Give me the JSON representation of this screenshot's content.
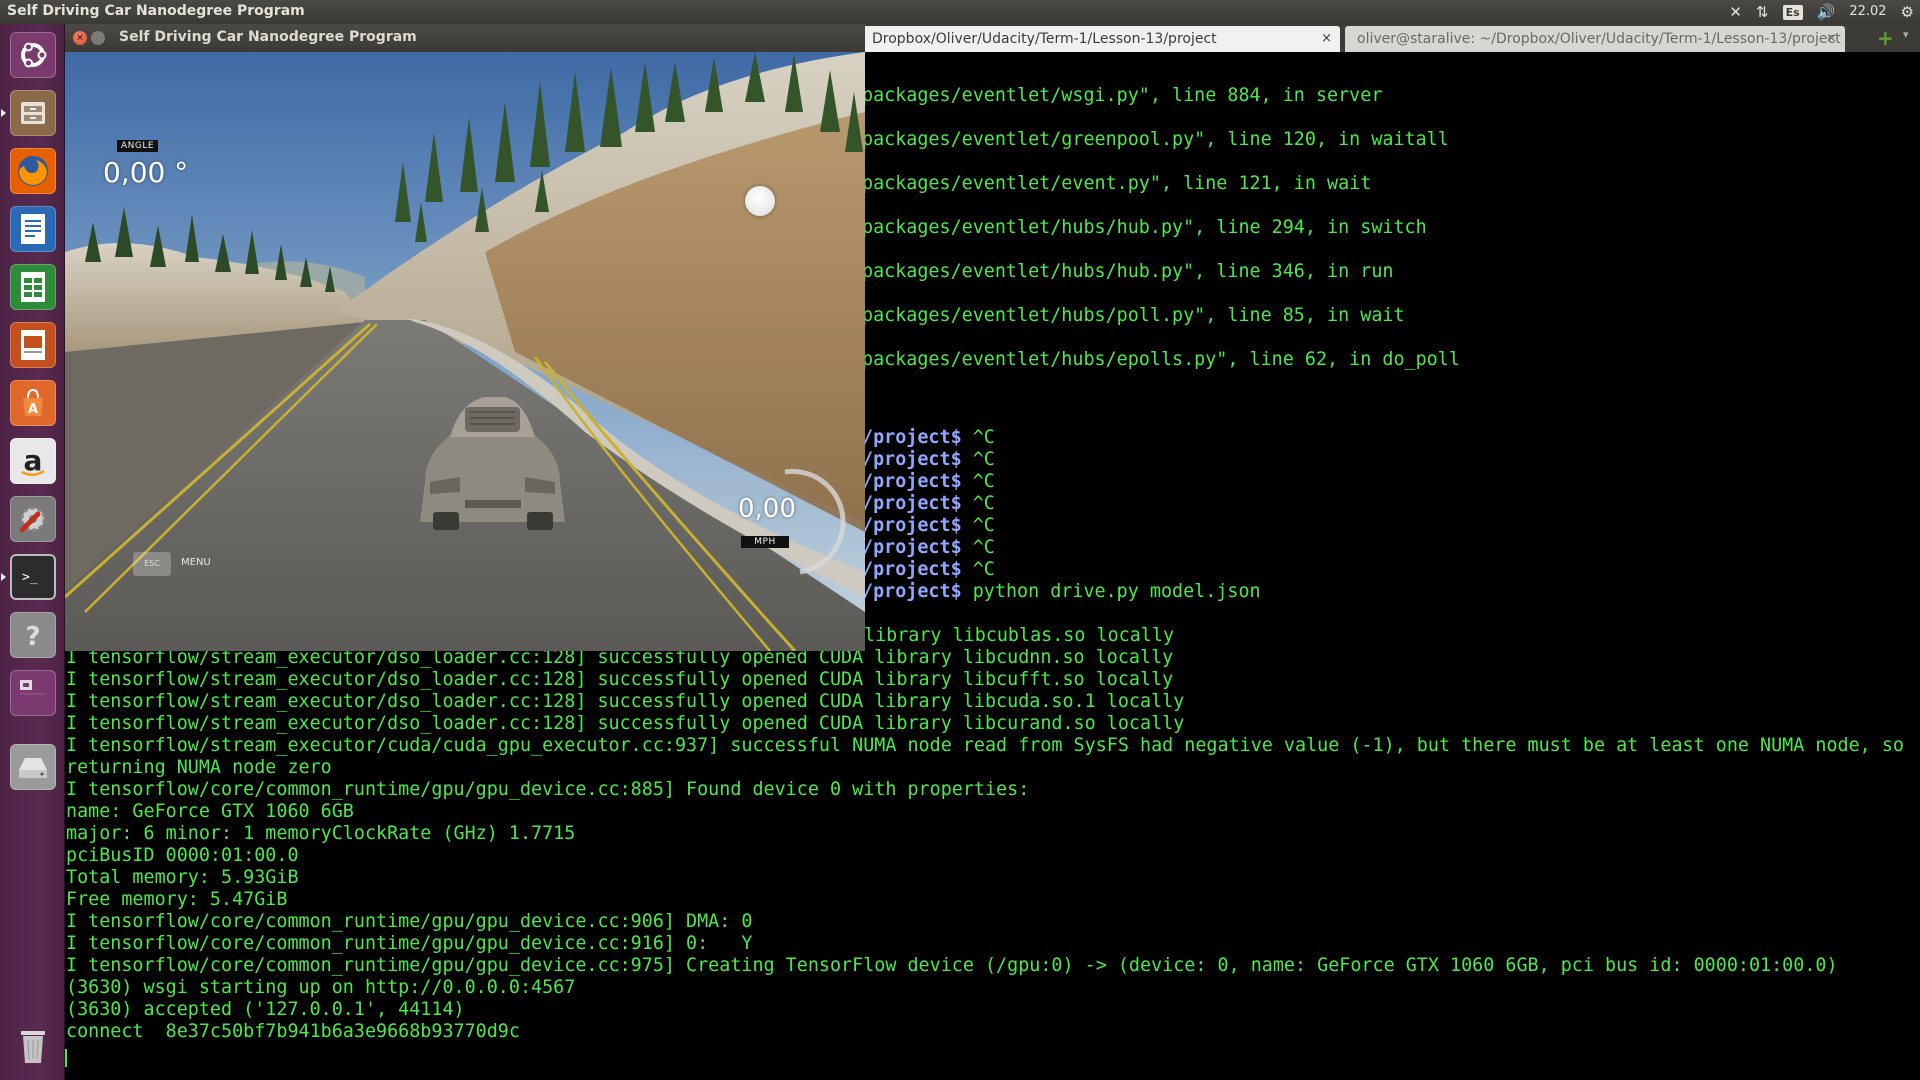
{
  "top_panel": {
    "title": "Self Driving Car Nanodegree Program",
    "keyboard_layout": "Es",
    "clock": "22.02"
  },
  "launcher": {
    "items": [
      {
        "name": "dash",
        "icon": "ubuntu-logo-icon",
        "color": "#7a3a6e"
      },
      {
        "name": "files",
        "icon": "file-cabinet-icon",
        "color": "#8b6a4a"
      },
      {
        "name": "firefox",
        "icon": "firefox-icon",
        "color": "#e66000"
      },
      {
        "name": "writer",
        "icon": "document-icon",
        "color": "#2a6ab4"
      },
      {
        "name": "calc",
        "icon": "spreadsheet-icon",
        "color": "#2e8b3a"
      },
      {
        "name": "impress",
        "icon": "presentation-icon",
        "color": "#c4501e"
      },
      {
        "name": "software-center",
        "icon": "shopping-bag-icon",
        "color": "#e0682a"
      },
      {
        "name": "amazon",
        "icon": "amazon-icon",
        "color": "#e8e8e8"
      },
      {
        "name": "settings",
        "icon": "wrench-gear-icon",
        "color": "#b03020"
      },
      {
        "name": "terminal",
        "icon": "terminal-icon",
        "color": "#2c2c2c"
      },
      {
        "name": "help",
        "icon": "question-icon",
        "color": "#8a8a8a"
      },
      {
        "name": "workspaces",
        "icon": "workspace-icon",
        "color": "#7a3a70"
      },
      {
        "name": "drive",
        "icon": "disk-drive-icon",
        "color": "#9a9a9a"
      },
      {
        "name": "trash",
        "icon": "trash-icon",
        "color": "#a8a8a8"
      }
    ]
  },
  "terminal": {
    "tabs": [
      {
        "label": "Dropbox/Oliver/Udacity/Term-1/Lesson-13/project",
        "close": "×"
      },
      {
        "label": "oliver@staralive: ~/Dropbox/Oliver/Udacity/Term-1/Lesson-13/project",
        "close": "×"
      }
    ],
    "new_tab": "+",
    "upper_lines": [
      "packages/eventlet/wsgi.py\", line 884, in server",
      "packages/eventlet/greenpool.py\", line 120, in waitall",
      "packages/eventlet/event.py\", line 121, in wait",
      "packages/eventlet/hubs/hub.py\", line 294, in switch",
      "packages/eventlet/hubs/hub.py\", line 346, in run",
      "packages/eventlet/hubs/poll.py\", line 85, in wait",
      "packages/eventlet/hubs/epolls.py\", line 62, in do_poll"
    ],
    "prompt_lines": [
      {
        "prompt": "/project$",
        "cmd": " ^C"
      },
      {
        "prompt": "/project$",
        "cmd": " ^C"
      },
      {
        "prompt": "/project$",
        "cmd": " ^C"
      },
      {
        "prompt": "/project$",
        "cmd": " ^C"
      },
      {
        "prompt": "/project$",
        "cmd": " ^C"
      },
      {
        "prompt": "/project$",
        "cmd": " ^C"
      },
      {
        "prompt": "/project$",
        "cmd": " ^C"
      },
      {
        "prompt": "/project$",
        "cmd": " python drive.py model.json"
      }
    ],
    "library_line": "library libcublas.so locally",
    "lower_lines": [
      "I tensorflow/stream_executor/dso_loader.cc:128] successfully opened CUDA library libcudnn.so locally",
      "I tensorflow/stream_executor/dso_loader.cc:128] successfully opened CUDA library libcufft.so locally",
      "I tensorflow/stream_executor/dso_loader.cc:128] successfully opened CUDA library libcuda.so.1 locally",
      "I tensorflow/stream_executor/dso_loader.cc:128] successfully opened CUDA library libcurand.so locally",
      "I tensorflow/stream_executor/cuda/cuda_gpu_executor.cc:937] successful NUMA node read from SysFS had negative value (-1), but there must be at least one NUMA node, so",
      "returning NUMA node zero",
      "I tensorflow/core/common_runtime/gpu/gpu_device.cc:885] Found device 0 with properties:",
      "name: GeForce GTX 1060 6GB",
      "major: 6 minor: 1 memoryClockRate (GHz) 1.7715",
      "pciBusID 0000:01:00.0",
      "Total memory: 5.93GiB",
      "Free memory: 5.47GiB",
      "I tensorflow/core/common_runtime/gpu/gpu_device.cc:906] DMA: 0",
      "I tensorflow/core/common_runtime/gpu/gpu_device.cc:916] 0:   Y",
      "I tensorflow/core/common_runtime/gpu/gpu_device.cc:975] Creating TensorFlow device (/gpu:0) -> (device: 0, name: GeForce GTX 1060 6GB, pci bus id: 0000:01:00.0)",
      "(3630) wsgi starting up on http://0.0.0.0:4567",
      "(3630) accepted ('127.0.0.1', 44114)",
      "connect  8e37c50bf7b941b6a3e9668b93770d9c"
    ],
    "text_color": "#4be84b",
    "prompt_color": "#8fa7ff"
  },
  "simulator": {
    "window_title": "Self Driving Car Nanodegree Program",
    "angle_label": "ANGLE",
    "angle_value": "0,00 °",
    "speed_value": "0,00",
    "speed_unit": "MPH",
    "esc_label": "ESC",
    "menu_label": "MENU"
  }
}
